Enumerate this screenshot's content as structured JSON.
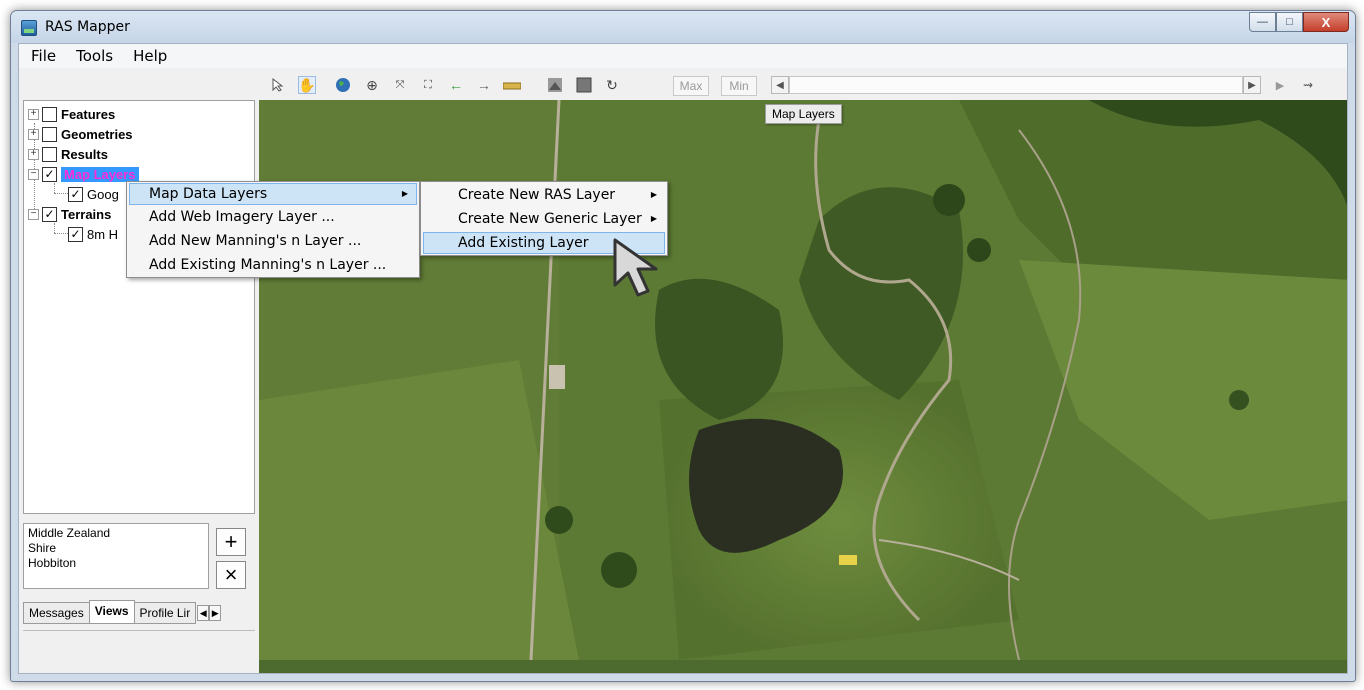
{
  "window": {
    "title": "RAS Mapper",
    "controls": {
      "minimize": "—",
      "maximize": "□",
      "close": "X"
    }
  },
  "menubar": {
    "items": [
      "File",
      "Tools",
      "Help"
    ]
  },
  "toolbar": {
    "max_label": "Max",
    "min_label": "Min",
    "icons": [
      "select-arrow-icon",
      "pan-hand-icon",
      "globe-icon",
      "zoom-in-icon",
      "zoom-out-icon",
      "full-extent-icon",
      "back-arrow-icon",
      "forward-arrow-icon",
      "measure-icon",
      "terrain-icon",
      "grid-icon",
      "plot-icon"
    ]
  },
  "tree": {
    "features": "Features",
    "geometries": "Geometries",
    "results": "Results",
    "map_layers": "Map Layers",
    "google": "Goog",
    "terrains": "Terrains",
    "terrain_item": "8m H"
  },
  "views": {
    "items": [
      "Middle Zealand",
      "Shire",
      "Hobbiton"
    ],
    "add_label": "+",
    "remove_label": "×"
  },
  "tabs": {
    "items": [
      "Messages",
      "Views",
      "Profile Lir"
    ],
    "active": "Views"
  },
  "map": {
    "tooltip": "Map Layers"
  },
  "context_menu": {
    "items": [
      "Map Data Layers",
      "Add Web Imagery Layer ...",
      "Add New Manning's n Layer ...",
      "Add Existing Manning's n Layer ..."
    ],
    "selected": "Map Data Layers"
  },
  "submenu": {
    "items": [
      "Create New RAS Layer",
      "Create New Generic Layer",
      "Add Existing Layer"
    ],
    "selected": "Add Existing Layer"
  }
}
